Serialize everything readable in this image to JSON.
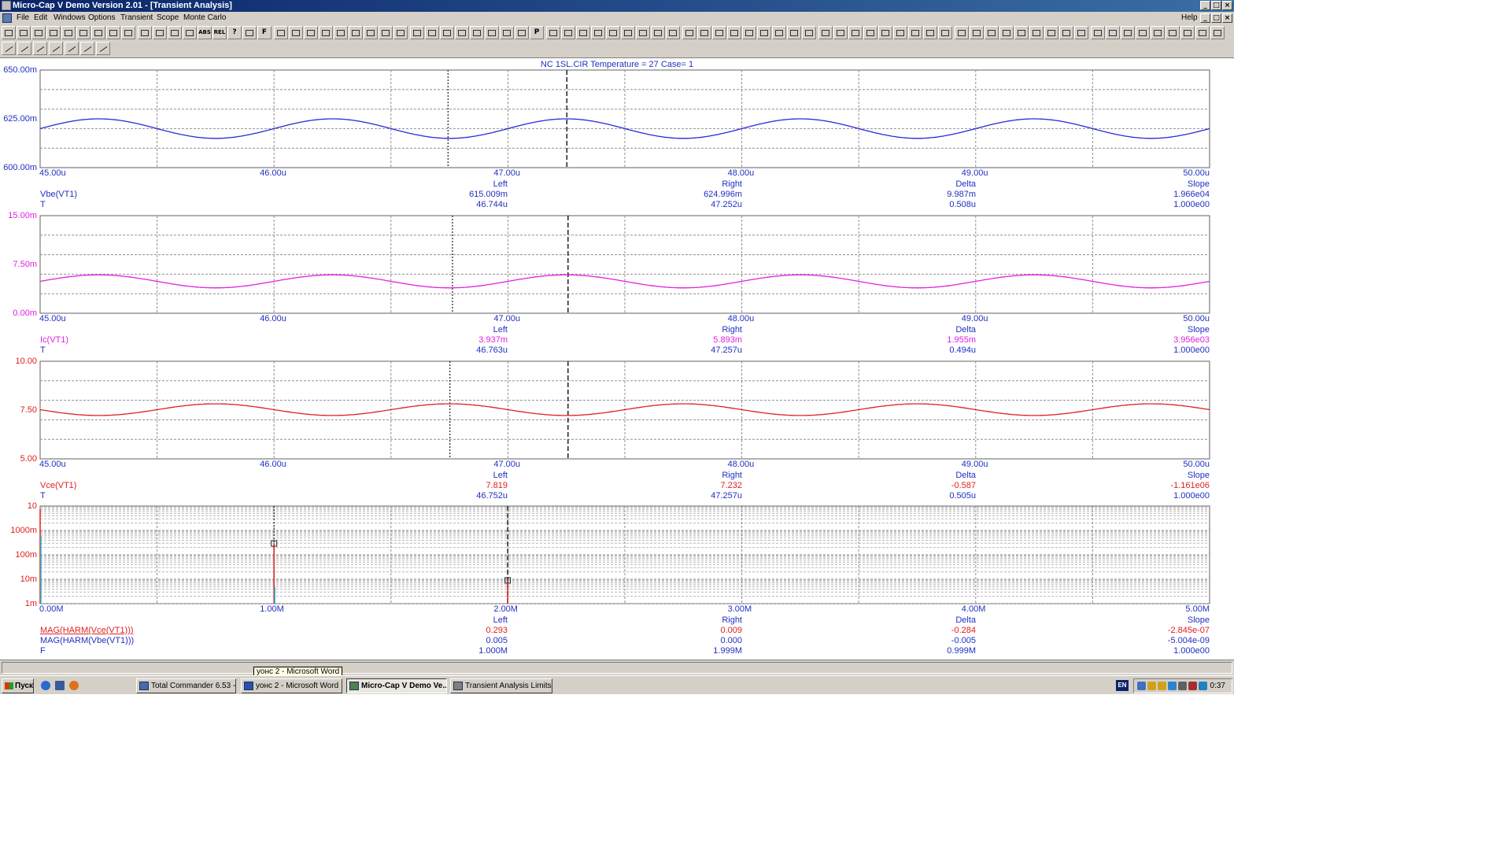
{
  "window": {
    "title": "Micro-Cap V Demo Version 2.01 - [Transient Analysis]",
    "controls": [
      "_",
      "□",
      "×"
    ],
    "doc_controls": [
      "_",
      "□",
      "×"
    ]
  },
  "menu": {
    "items": [
      "File",
      "Edit",
      "Windows",
      "Options",
      "Transient",
      "Scope",
      "Monte Carlo"
    ],
    "help": "Help"
  },
  "toolbar": {
    "text_buttons": {
      "abs": "ABS",
      "rel": "REL",
      "help": "?",
      "font": "F",
      "p": "P"
    }
  },
  "plot_title": "NC  1SL.CIR Temperature = 27 Case= 1",
  "chart_data": [
    {
      "type": "line",
      "title": "",
      "xlabel": "",
      "ylabel": "",
      "xlim": [
        45.0,
        50.0
      ],
      "ylim": [
        600.0,
        650.0
      ],
      "y_ticks": [
        "650.00m",
        "625.00m",
        "600.00m"
      ],
      "x_ticks": [
        "45.00u",
        "46.00u",
        "47.00u",
        "48.00u",
        "49.00u",
        "50.00u"
      ],
      "grid": true,
      "color": "#2828d8",
      "series": [
        {
          "name": "Vbe(VT1)",
          "x_unit": "us",
          "offset": 620.0,
          "amplitude": 5.0,
          "period": 1.0,
          "phase_peak_x": 46.25
        }
      ],
      "cursors": {
        "left_x": 46.744,
        "right_x": 47.252
      },
      "readout": {
        "headers": [
          "Left",
          "Right",
          "Delta",
          "Slope"
        ],
        "rows": [
          {
            "label": "Vbe(VT1)",
            "values": [
              "615.009m",
              "624.996m",
              "9.987m",
              "1.966e04"
            ]
          },
          {
            "label": "T",
            "values": [
              "46.744u",
              "47.252u",
              "0.508u",
              "1.000e00"
            ]
          }
        ]
      }
    },
    {
      "type": "line",
      "title": "",
      "xlabel": "",
      "ylabel": "",
      "xlim": [
        45.0,
        50.0
      ],
      "ylim": [
        0.0,
        15.0
      ],
      "y_ticks": [
        "15.00m",
        "7.50m",
        "0.00m"
      ],
      "x_ticks": [
        "45.00u",
        "46.00u",
        "47.00u",
        "48.00u",
        "49.00u",
        "50.00u"
      ],
      "grid": true,
      "color": "#e020e0",
      "series": [
        {
          "name": "Ic(VT1)",
          "x_unit": "us",
          "offset": 4.9,
          "amplitude": 1.0,
          "period": 1.0,
          "phase_peak_x": 46.25
        }
      ],
      "cursors": {
        "left_x": 46.763,
        "right_x": 47.257
      },
      "readout": {
        "headers": [
          "Left",
          "Right",
          "Delta",
          "Slope"
        ],
        "rows": [
          {
            "label": "Ic(VT1)",
            "values": [
              "3.937m",
              "5.893m",
              "1.955m",
              "3.956e03"
            ]
          },
          {
            "label": "T",
            "values": [
              "46.763u",
              "47.257u",
              "0.494u",
              "1.000e00"
            ]
          }
        ]
      }
    },
    {
      "type": "line",
      "title": "",
      "xlabel": "",
      "ylabel": "",
      "xlim": [
        45.0,
        50.0
      ],
      "ylim": [
        5.0,
        10.0
      ],
      "y_ticks": [
        "10.00",
        "7.50",
        "5.00"
      ],
      "x_ticks": [
        "45.00u",
        "46.00u",
        "47.00u",
        "48.00u",
        "49.00u",
        "50.00u"
      ],
      "grid": true,
      "color": "#e02020",
      "series": [
        {
          "name": "Vce(VT1)",
          "x_unit": "us",
          "offset": 7.52,
          "amplitude": 0.3,
          "period": 1.0,
          "phase_peak_x": 46.75
        }
      ],
      "cursors": {
        "left_x": 46.752,
        "right_x": 47.257
      },
      "readout": {
        "headers": [
          "Left",
          "Right",
          "Delta",
          "Slope"
        ],
        "rows": [
          {
            "label": "Vce(VT1)",
            "values": [
              "7.819",
              "7.232",
              "-0.587",
              "-1.161e06"
            ]
          },
          {
            "label": "T",
            "values": [
              "46.752u",
              "47.257u",
              "0.505u",
              "1.000e00"
            ]
          }
        ]
      }
    },
    {
      "type": "bar",
      "title": "",
      "xlabel": "",
      "ylabel": "",
      "xlim": [
        0.0,
        5.0
      ],
      "ylim": [
        0.001,
        10
      ],
      "y_scale": "log",
      "y_ticks": [
        "10",
        "1000m",
        "100m",
        "10m",
        "1m"
      ],
      "x_ticks": [
        "0.00M",
        "1.00M",
        "2.00M",
        "3.00M",
        "4.00M",
        "5.00M"
      ],
      "grid": true,
      "series": [
        {
          "name": "MAG(HARM(Vce(VT1)))",
          "color": "#e02020",
          "x": [
            0.0,
            1.0,
            1.999
          ],
          "values": [
            7.5,
            0.293,
            0.009
          ]
        },
        {
          "name": "MAG(HARM(Vbe(VT1)))",
          "color": "#2030c0",
          "x": [
            0.0,
            1.0,
            1.999
          ],
          "values": [
            0.62,
            0.005,
            0.0002
          ]
        }
      ],
      "cursors": {
        "left_x": 1.0,
        "right_x": 1.999
      },
      "readout": {
        "headers": [
          "Left",
          "Right",
          "Delta",
          "Slope"
        ],
        "rows": [
          {
            "label": "MAG(HARM(Vce(VT1)))",
            "values": [
              "0.293",
              "0.009",
              "-0.284",
              "-2.845e-07"
            ]
          },
          {
            "label": "MAG(HARM(Vbe(VT1)))",
            "values": [
              "0.005",
              "0.000",
              "-0.005",
              "-5.004e-09"
            ]
          },
          {
            "label": "F",
            "values": [
              "1.000M",
              "1.999M",
              "0.999M",
              "1.000e00"
            ]
          }
        ]
      }
    }
  ],
  "tooltip": "уонс 2 - Microsoft Word",
  "taskbar": {
    "start": "Пуск",
    "tasks": [
      "Total Commander 6.53 - ...",
      "уонс 2 - Microsoft Word",
      "Micro-Cap V Demo Ve...",
      "Transient Analysis Limits"
    ],
    "language": "EN",
    "clock": "0:37"
  }
}
